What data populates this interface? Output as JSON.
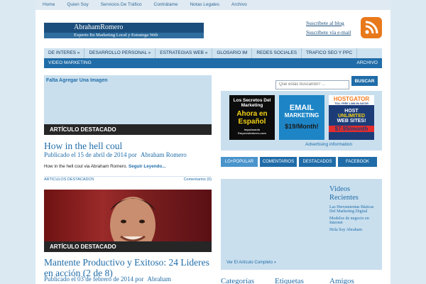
{
  "top_nav": [
    "Home",
    "Quien Soy",
    "Servicios De Tráfico",
    "Contrátame",
    "Notas Legales",
    "Archivo"
  ],
  "logo": {
    "name": "AbrahamRomero",
    "tagline": "Experto En Marketing Local y Estratega Web"
  },
  "subscribe": {
    "blog": "Suscríbete al blog",
    "email": "Suscríbete vía e-mail"
  },
  "main_nav": [
    "DE INTERES »",
    "DESARROLLO PERSONAL »",
    "ESTRATEGIAS WEB »",
    "GLOSARIO IM",
    "REDES SOCIALES",
    "TRAFICO SEO Y PPC"
  ],
  "sub_nav": {
    "left": "VIDEO MARKETING",
    "right": "ARCHIVO"
  },
  "search": {
    "placeholder": "Que estas buscando? ...",
    "button": "BUSCAR"
  },
  "post1": {
    "image_note": "Falta Agregar Una Imagen",
    "label": "ARTÍCULO DESTACADO",
    "title": "How in the hell coul",
    "meta_prefix": "Publicado el 15 de abril de 2014 por",
    "author": "Abraham Romero",
    "excerpt": "How in the hell coul via Abraham Romero.",
    "read_more": "Seguir Leyendo...",
    "foot_left": "ARTICULOS DESTACADOS",
    "foot_right": "Comentarios (0)"
  },
  "post2": {
    "label": "ARTÍCULO DESTACADO",
    "title": "Mantente Productivo y Exitoso: 24 Lideres en acción (2 de 8)",
    "meta_prefix": "Publicado el 03 de febrero de 2014 por",
    "author": "Abraham"
  },
  "ads": [
    {
      "lines": [
        "Los Secretos Del",
        "Marketing",
        "Ahora en",
        "Español",
        "Impulsando",
        "Emprendedores.com"
      ]
    },
    {
      "lines": [
        "EMAIL",
        "MARKETING",
        "$19/Month!"
      ]
    },
    {
      "lines": [
        "HOSTGATOR",
        "TOLL FREE 1-866-96-GATOR",
        "HOST",
        "UNLIMITED",
        "WEB SITES!",
        "$7.95/month"
      ]
    }
  ],
  "advertising_info": "Advertising information",
  "tabs": [
    "LO+POPULAR",
    "COMENTARIOS",
    "DESTACADOS",
    "FACEBOOK"
  ],
  "videos": {
    "title": "Videos Recientes",
    "items": [
      "Las Herramientas Básicas Del Marketing Digital",
      "Modelos de negocio en Internet",
      "Hola Soy Abraham"
    ],
    "link": "Ver El Artículo Completo »"
  },
  "bottom_heads": [
    "Categorías",
    "Etiquetas",
    "Amigos"
  ],
  "colors": {
    "accent": "#1f6ca8",
    "panel": "#c9dfee",
    "rss": "#e8791b"
  }
}
